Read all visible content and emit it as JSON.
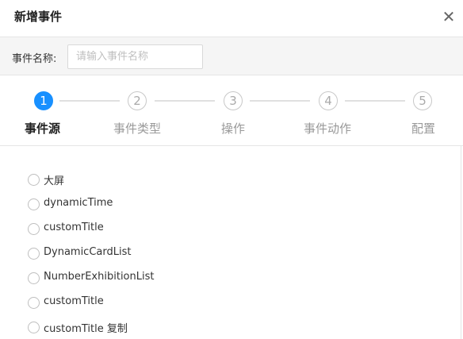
{
  "dialog": {
    "title": "新增事件",
    "close_icon": "close-icon"
  },
  "name_field": {
    "label": "事件名称:",
    "value": "",
    "placeholder": "请输入事件名称"
  },
  "steps": [
    {
      "number": "1",
      "label": "事件源",
      "active": true
    },
    {
      "number": "2",
      "label": "事件类型",
      "active": false
    },
    {
      "number": "3",
      "label": "操作",
      "active": false
    },
    {
      "number": "4",
      "label": "事件动作",
      "active": false
    },
    {
      "number": "5",
      "label": "配置",
      "active": false
    }
  ],
  "sources": [
    {
      "label": "大屏",
      "checked": false
    },
    {
      "label": "dynamicTime",
      "checked": false
    },
    {
      "label": "customTitle",
      "checked": false
    },
    {
      "label": "DynamicCardList",
      "checked": false
    },
    {
      "label": "NumberExhibitionList",
      "checked": false
    },
    {
      "label": "customTitle",
      "checked": false
    },
    {
      "label": "customTitle 复制",
      "checked": false
    }
  ],
  "colors": {
    "accent": "#1890ff",
    "inactive_step": "#c8c8c8",
    "bar_background": "#f5f5f5"
  }
}
